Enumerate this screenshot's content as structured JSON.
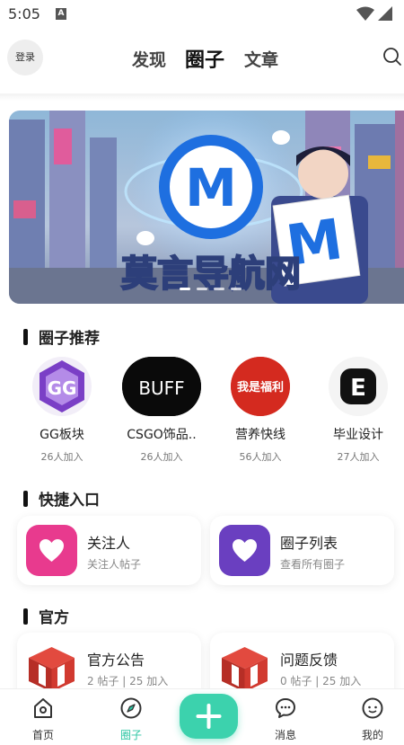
{
  "status_bar": {
    "time": "5:05",
    "notification_letter": "A"
  },
  "top_nav": {
    "login": "登录",
    "tabs": [
      {
        "label": "发现",
        "active": false
      },
      {
        "label": "圈子",
        "active": true
      },
      {
        "label": "文章",
        "active": false
      }
    ],
    "search_icon": "search-icon"
  },
  "banner": {
    "text": "莫言导航网",
    "logo_letter": "M",
    "dots": 4,
    "active_dot": 0
  },
  "recommended": {
    "title": "圈子推荐",
    "items": [
      {
        "name": "GG板块",
        "count": "26人加入",
        "logo": "GG"
      },
      {
        "name": "CSGO饰品..",
        "count": "26人加入",
        "logo": "BUFF"
      },
      {
        "name": "营养快线",
        "count": "56人加入",
        "logo": "我是福利"
      },
      {
        "name": "毕业设计",
        "count": "27人加入",
        "logo": "E"
      }
    ]
  },
  "quick_entry": {
    "title": "快捷入口",
    "items": [
      {
        "title": "关注人",
        "subtitle": "关注人帖子",
        "color": "#e83a8e",
        "icon": "heart-icon"
      },
      {
        "title": "圈子列表",
        "subtitle": "查看所有圈子",
        "color": "#6a3fc0",
        "icon": "heart-icon"
      }
    ]
  },
  "official": {
    "title": "官方",
    "items": [
      {
        "title": "官方公告",
        "subtitle": "2 帖子 | 25 加入",
        "icon": "box-icon"
      },
      {
        "title": "问题反馈",
        "subtitle": "0 帖子 | 25 加入",
        "icon": "box-icon"
      }
    ]
  },
  "bottom_nav": {
    "items": [
      {
        "label": "首页",
        "icon": "home-icon",
        "active": false
      },
      {
        "label": "圈子",
        "icon": "compass-icon",
        "active": true
      },
      {
        "label": "",
        "icon": "plus-icon",
        "active": false
      },
      {
        "label": "消息",
        "icon": "message-icon",
        "active": false
      },
      {
        "label": "我的",
        "icon": "profile-icon",
        "active": false
      }
    ]
  },
  "colors": {
    "accent": "#3cd2ad",
    "active_tab": "#2cc6a3"
  }
}
